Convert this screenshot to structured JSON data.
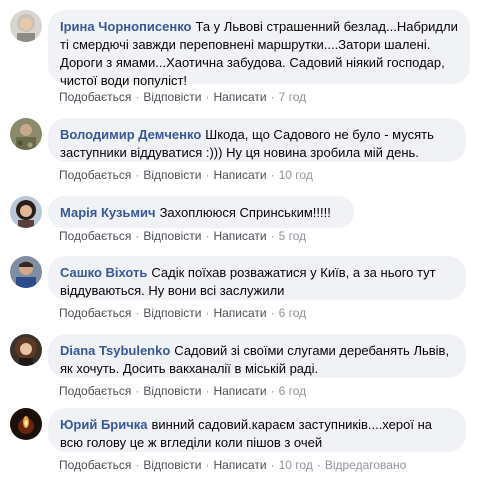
{
  "comments": [
    {
      "author": "Ірина Чорнописенко",
      "text": "Та у Львові страшенний безлад...Набридли ті смердючі завжди переповнені маршрутки....Затори шалені. Дороги з ямами...Хаотична забудова. Садовий ніякий господар, чистої води популіст!",
      "like": "Подобається",
      "reply": "Відповісти",
      "write": "Написати",
      "time": "7 год",
      "edited": "",
      "avatar_icon": "woman-grey-hair-avatar-icon"
    },
    {
      "author": "Володимир Демченко",
      "text": "Шкода, що Садового не було - мусять заступники віддуватися :))) Ну ця новина зробила мій день.",
      "like": "Подобається",
      "reply": "Відповісти",
      "write": "Написати",
      "time": "10 год",
      "edited": "",
      "avatar_icon": "camouflage-man-avatar-icon"
    },
    {
      "author": "Марія Кузьмич",
      "text": "Захоплююся Спринським!!!!!",
      "like": "Подобається",
      "reply": "Відповісти",
      "write": "Написати",
      "time": "5 год",
      "edited": "",
      "avatar_icon": "woman-dark-hair-avatar-icon"
    },
    {
      "author": "Сашко Віхоть",
      "text": "Садік поїхав розважатися у Київ, а за нього тут віддуваються. Ну вони всі заслужили",
      "like": "Подобається",
      "reply": "Відповісти",
      "write": "Написати",
      "time": "6 год",
      "edited": "",
      "avatar_icon": "man-blue-shirt-avatar-icon"
    },
    {
      "author": "Diana Tsybulenko",
      "text": "Садовий зі своїми слугами деребанять Львів, як хочуть. Досить вакханалії в міській раді.",
      "like": "Подобається",
      "reply": "Відповісти",
      "write": "Написати",
      "time": "6 год",
      "edited": "",
      "avatar_icon": "woman-long-hair-avatar-icon"
    },
    {
      "author": "Юрий Бричка",
      "text": "винний садовий.караєм заступників....херої на всю голову це ж вгледіли коли пішов з очей",
      "like": "Подобається",
      "reply": "Відповісти",
      "write": "Написати",
      "time": "10 год",
      "edited": "Відредаговано",
      "avatar_icon": "candle-dark-avatar-icon"
    }
  ],
  "colors": {
    "author": "#385898",
    "bubble": "#f0f2f5",
    "text": "#050505",
    "meta": "#4b4f56"
  }
}
